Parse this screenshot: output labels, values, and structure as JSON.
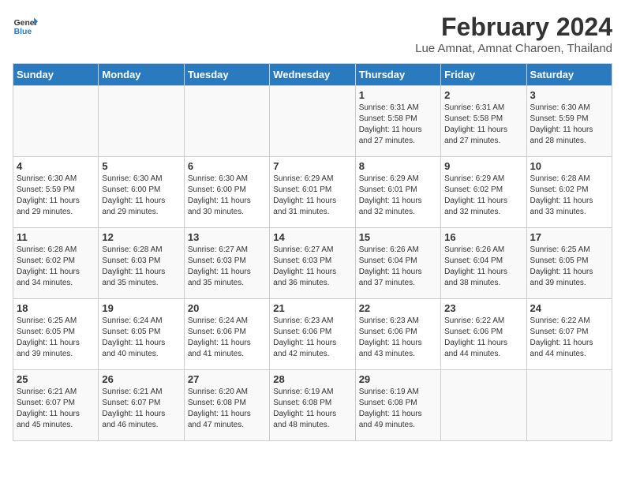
{
  "logo": {
    "text_general": "General",
    "text_blue": "Blue"
  },
  "title": "February 2024",
  "subtitle": "Lue Amnat, Amnat Charoen, Thailand",
  "days_of_week": [
    "Sunday",
    "Monday",
    "Tuesday",
    "Wednesday",
    "Thursday",
    "Friday",
    "Saturday"
  ],
  "weeks": [
    [
      {
        "num": "",
        "info": ""
      },
      {
        "num": "",
        "info": ""
      },
      {
        "num": "",
        "info": ""
      },
      {
        "num": "",
        "info": ""
      },
      {
        "num": "1",
        "info": "Sunrise: 6:31 AM\nSunset: 5:58 PM\nDaylight: 11 hours\nand 27 minutes."
      },
      {
        "num": "2",
        "info": "Sunrise: 6:31 AM\nSunset: 5:58 PM\nDaylight: 11 hours\nand 27 minutes."
      },
      {
        "num": "3",
        "info": "Sunrise: 6:30 AM\nSunset: 5:59 PM\nDaylight: 11 hours\nand 28 minutes."
      }
    ],
    [
      {
        "num": "4",
        "info": "Sunrise: 6:30 AM\nSunset: 5:59 PM\nDaylight: 11 hours\nand 29 minutes."
      },
      {
        "num": "5",
        "info": "Sunrise: 6:30 AM\nSunset: 6:00 PM\nDaylight: 11 hours\nand 29 minutes."
      },
      {
        "num": "6",
        "info": "Sunrise: 6:30 AM\nSunset: 6:00 PM\nDaylight: 11 hours\nand 30 minutes."
      },
      {
        "num": "7",
        "info": "Sunrise: 6:29 AM\nSunset: 6:01 PM\nDaylight: 11 hours\nand 31 minutes."
      },
      {
        "num": "8",
        "info": "Sunrise: 6:29 AM\nSunset: 6:01 PM\nDaylight: 11 hours\nand 32 minutes."
      },
      {
        "num": "9",
        "info": "Sunrise: 6:29 AM\nSunset: 6:02 PM\nDaylight: 11 hours\nand 32 minutes."
      },
      {
        "num": "10",
        "info": "Sunrise: 6:28 AM\nSunset: 6:02 PM\nDaylight: 11 hours\nand 33 minutes."
      }
    ],
    [
      {
        "num": "11",
        "info": "Sunrise: 6:28 AM\nSunset: 6:02 PM\nDaylight: 11 hours\nand 34 minutes."
      },
      {
        "num": "12",
        "info": "Sunrise: 6:28 AM\nSunset: 6:03 PM\nDaylight: 11 hours\nand 35 minutes."
      },
      {
        "num": "13",
        "info": "Sunrise: 6:27 AM\nSunset: 6:03 PM\nDaylight: 11 hours\nand 35 minutes."
      },
      {
        "num": "14",
        "info": "Sunrise: 6:27 AM\nSunset: 6:03 PM\nDaylight: 11 hours\nand 36 minutes."
      },
      {
        "num": "15",
        "info": "Sunrise: 6:26 AM\nSunset: 6:04 PM\nDaylight: 11 hours\nand 37 minutes."
      },
      {
        "num": "16",
        "info": "Sunrise: 6:26 AM\nSunset: 6:04 PM\nDaylight: 11 hours\nand 38 minutes."
      },
      {
        "num": "17",
        "info": "Sunrise: 6:25 AM\nSunset: 6:05 PM\nDaylight: 11 hours\nand 39 minutes."
      }
    ],
    [
      {
        "num": "18",
        "info": "Sunrise: 6:25 AM\nSunset: 6:05 PM\nDaylight: 11 hours\nand 39 minutes."
      },
      {
        "num": "19",
        "info": "Sunrise: 6:24 AM\nSunset: 6:05 PM\nDaylight: 11 hours\nand 40 minutes."
      },
      {
        "num": "20",
        "info": "Sunrise: 6:24 AM\nSunset: 6:06 PM\nDaylight: 11 hours\nand 41 minutes."
      },
      {
        "num": "21",
        "info": "Sunrise: 6:23 AM\nSunset: 6:06 PM\nDaylight: 11 hours\nand 42 minutes."
      },
      {
        "num": "22",
        "info": "Sunrise: 6:23 AM\nSunset: 6:06 PM\nDaylight: 11 hours\nand 43 minutes."
      },
      {
        "num": "23",
        "info": "Sunrise: 6:22 AM\nSunset: 6:06 PM\nDaylight: 11 hours\nand 44 minutes."
      },
      {
        "num": "24",
        "info": "Sunrise: 6:22 AM\nSunset: 6:07 PM\nDaylight: 11 hours\nand 44 minutes."
      }
    ],
    [
      {
        "num": "25",
        "info": "Sunrise: 6:21 AM\nSunset: 6:07 PM\nDaylight: 11 hours\nand 45 minutes."
      },
      {
        "num": "26",
        "info": "Sunrise: 6:21 AM\nSunset: 6:07 PM\nDaylight: 11 hours\nand 46 minutes."
      },
      {
        "num": "27",
        "info": "Sunrise: 6:20 AM\nSunset: 6:08 PM\nDaylight: 11 hours\nand 47 minutes."
      },
      {
        "num": "28",
        "info": "Sunrise: 6:19 AM\nSunset: 6:08 PM\nDaylight: 11 hours\nand 48 minutes."
      },
      {
        "num": "29",
        "info": "Sunrise: 6:19 AM\nSunset: 6:08 PM\nDaylight: 11 hours\nand 49 minutes."
      },
      {
        "num": "",
        "info": ""
      },
      {
        "num": "",
        "info": ""
      }
    ]
  ]
}
